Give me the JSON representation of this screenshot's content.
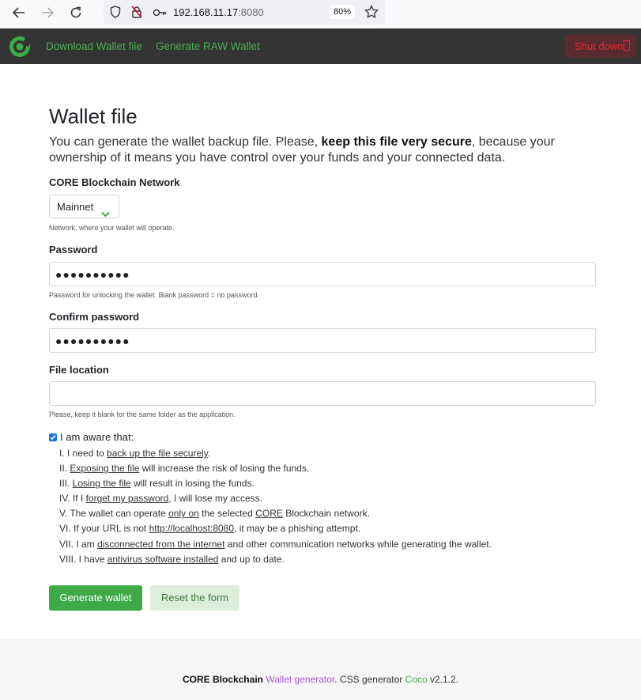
{
  "browser": {
    "url_host": "192.168.11.17",
    "url_port": ":8080",
    "zoom": "80%",
    "icons": [
      "back-arrow-icon",
      "forward-arrow-icon",
      "reload-icon",
      "shield-icon",
      "not-secure-lock-icon",
      "key-icon",
      "bookmark-star-icon"
    ]
  },
  "header": {
    "nav": [
      "Download Wallet file",
      "Generate RAW Wallet"
    ],
    "shutdown_label": "Shut down",
    "logo": "core-logo-icon"
  },
  "main": {
    "title": "Wallet file",
    "lead_part1": "You can generate the wallet backup file. Please, ",
    "lead_bold": "keep this file very secure",
    "lead_part2": ", because your ownership of it means you have control over your funds and your connected data.",
    "network": {
      "label": "CORE Blockchain Network",
      "value": "Mainnet",
      "help": "Network, where your wallet will operate."
    },
    "password": {
      "label": "Password",
      "value": "●●●●●●●●●●",
      "help": "Password for unlocking the wallet. Blank password = no password."
    },
    "confirm": {
      "label": "Confirm password",
      "value": "●●●●●●●●●●"
    },
    "location": {
      "label": "File location",
      "value": "",
      "help": "Please, keep it blank for the same folder as the application."
    },
    "aware": {
      "label": "I am aware that:",
      "checked": true,
      "items": [
        {
          "pre": "I. I need to ",
          "link": "back up the file securely",
          "post": "."
        },
        {
          "pre": "II. ",
          "link": "Exposing the file",
          "post": " will increase the risk of losing the funds."
        },
        {
          "pre": "III. ",
          "link": "Losing the file",
          "post": " will result in losing the funds."
        },
        {
          "pre": "IV. If I ",
          "link": "forget my password",
          "post": ", I will lose my access."
        },
        {
          "pre": "V. The wallet can operate ",
          "link": "only on",
          "mid": " the selected ",
          "link2": "CORE",
          "post": " Blockchain network."
        },
        {
          "pre": "VI. If your URL is not ",
          "link": "http://localhost:8080",
          "post": ", it may be a phishing attempt."
        },
        {
          "pre": "VII. I am ",
          "link": "disconnected from the internet",
          "post": " and other communication networks while generating the wallet."
        },
        {
          "pre": "VIII. I have ",
          "link": "antivirus software installed",
          "post": " and up to date."
        }
      ]
    },
    "generate_label": "Generate wallet",
    "reset_label": "Reset the form"
  },
  "footer": {
    "brand": "CORE Blockchain",
    "app": "Wallet generator",
    "sep": ". CSS generator ",
    "css": "Coco",
    "version": " v2.1.2."
  },
  "colors": {
    "accent_green": "#3daa47",
    "header_bg": "#343434",
    "shutdown_red": "#e02b3a",
    "purple_link": "#a65ddb"
  }
}
